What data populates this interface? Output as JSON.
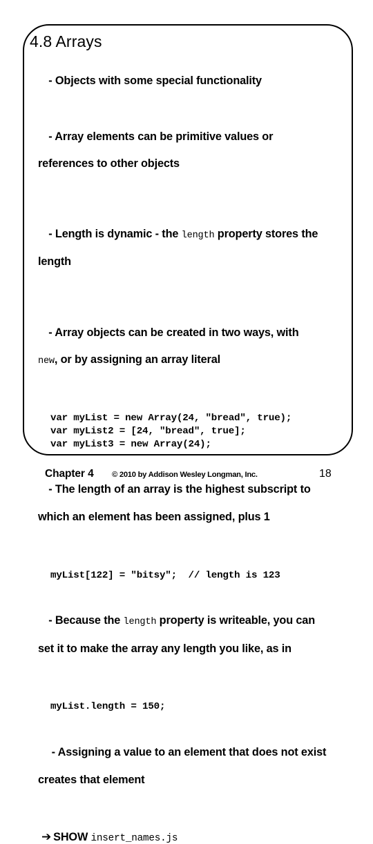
{
  "slide": {
    "title": "4.8 Arrays",
    "blocks": [
      {
        "kind": "bullet",
        "line1": "- Objects with some special functionality",
        "line2": ""
      },
      {
        "kind": "bullet",
        "line1": "- Array elements can be primitive values or",
        "line2": "references to other objects"
      },
      {
        "kind": "bullet-mono",
        "pre": "- Length is dynamic - the ",
        "mono": "length",
        "post": " property stores the",
        "line2": "length"
      },
      {
        "kind": "bullet-mono2",
        "line1": "- Array objects can be created in two ways, with",
        "mono2": "new",
        "post2": ", or by assigning an array literal"
      },
      {
        "kind": "code",
        "text": "var myList = new Array(24, \"bread\", true);\nvar myList2 = [24, \"bread\", true];\nvar myList3 = new Array(24);"
      },
      {
        "kind": "bullet",
        "line1": "- The length of an array is the highest subscript to",
        "line2": "which an element has been assigned, plus 1"
      },
      {
        "kind": "code",
        "text": "myList[122] = \"bitsy\";  // length is 123"
      },
      {
        "kind": "bullet-mono",
        "pre": "- Because the ",
        "mono": "length",
        "post": " property is writeable, you can",
        "line2": "set it to make the array any length you like, as in"
      },
      {
        "kind": "code",
        "text": "myList.length = 150;"
      },
      {
        "kind": "bullet",
        "line1": " - Assigning a value to an element that does not exist",
        "line2": "creates that element"
      },
      {
        "kind": "show",
        "arrow": "➔",
        "label": "SHOW",
        "file": "insert_names.js"
      }
    ]
  },
  "footer": {
    "chapter": "Chapter 4",
    "copyright": "© 2010 by Addison Wesley Longman, Inc.",
    "page_number": "18"
  }
}
